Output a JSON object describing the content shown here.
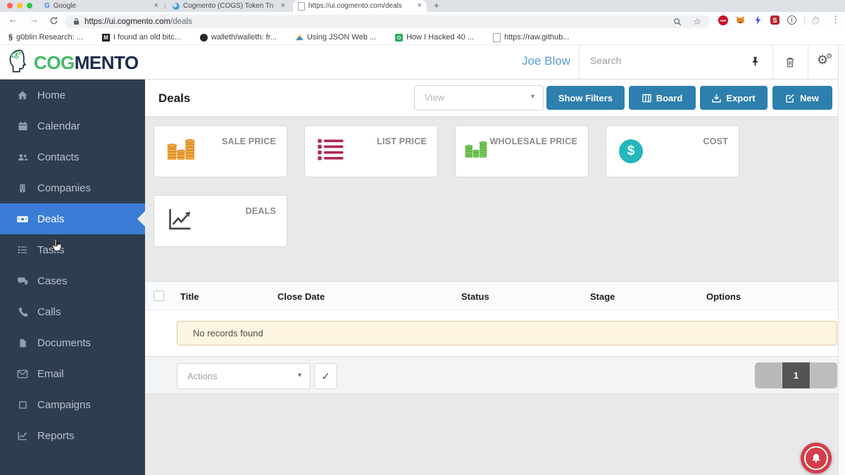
{
  "browser": {
    "tabs": [
      {
        "title": "Google"
      },
      {
        "title": "Cogmento (COGS) Token Trac"
      },
      {
        "title": "https://ui.cogmento.com/deals"
      }
    ],
    "url_host": "https://ui.cogmento.com",
    "url_path": "/deals",
    "bookmarks": [
      {
        "label": "g0blin Research: ..."
      },
      {
        "label": "I found an old bitc..."
      },
      {
        "label": "walleth/walleth: fr..."
      },
      {
        "label": "Using JSON Web ..."
      },
      {
        "label": "How I Hacked 40 ..."
      },
      {
        "label": "https://raw.github..."
      }
    ]
  },
  "header": {
    "brand_cog": "COG",
    "brand_mento": "MENTO",
    "user_name": "Joe Blow",
    "search_placeholder": "Search"
  },
  "sidebar": {
    "active_item": "Deals",
    "items": [
      {
        "label": "Home"
      },
      {
        "label": "Calendar"
      },
      {
        "label": "Contacts"
      },
      {
        "label": "Companies"
      },
      {
        "label": "Deals"
      },
      {
        "label": "Tasks"
      },
      {
        "label": "Cases"
      },
      {
        "label": "Calls"
      },
      {
        "label": "Documents"
      },
      {
        "label": "Email"
      },
      {
        "label": "Campaigns"
      },
      {
        "label": "Reports"
      }
    ]
  },
  "main": {
    "title": "Deals",
    "view_placeholder": "View",
    "buttons": {
      "show_filters": "Show Filters",
      "board": "Board",
      "export": "Export",
      "new": "New"
    },
    "cards": [
      {
        "label": "SALE PRICE"
      },
      {
        "label": "LIST PRICE"
      },
      {
        "label": "WHOLESALE PRICE"
      },
      {
        "label": "COST"
      },
      {
        "label": "DEALS"
      }
    ],
    "table": {
      "columns": [
        "Title",
        "Close Date",
        "Status",
        "Stage",
        "Options"
      ],
      "empty_message": "No records found"
    },
    "footer": {
      "actions_placeholder": "Actions",
      "page_current": "1"
    }
  },
  "glyphs": {
    "close": "×",
    "new_tab": "+",
    "caret_down": "▾",
    "check": "✓",
    "star": "☆",
    "back": "←",
    "forward": "→",
    "menu_dots": "⋮",
    "gear": "⚙",
    "dollar": "$",
    "google_g": "G",
    "medium_m": "M",
    "s_ext": "S",
    "abp": "ABP",
    "goblin": "§",
    "info": "!"
  },
  "colors": {
    "accent_blue": "#2d7fae",
    "sidebar_bg": "#2e3d50",
    "active_item_blue": "#3b7dd6",
    "brand_green": "#43b966",
    "brand_navy": "#1b2b4b",
    "coins_orange": "#f0a73e",
    "list_crimson": "#b0275a",
    "coins_green": "#7ac95b",
    "cost_teal": "#22b8bd",
    "notification_red": "#d43d49"
  }
}
